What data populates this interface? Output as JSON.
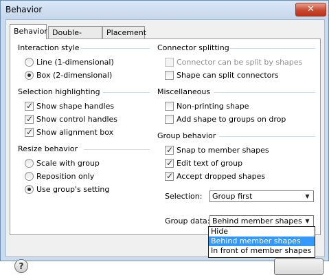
{
  "window": {
    "title": "Behavior",
    "close_glyph": "✕"
  },
  "tabs": [
    {
      "label": "Behavior",
      "active": true
    },
    {
      "label": "Double-Click",
      "active": false
    },
    {
      "label": "Placement",
      "active": false
    }
  ],
  "interaction_style": {
    "heading": "Interaction style",
    "options": [
      {
        "label": "Line (1-dimensional)",
        "selected": false
      },
      {
        "label": "Box (2-dimensional)",
        "selected": true
      }
    ]
  },
  "selection_highlighting": {
    "heading": "Selection highlighting",
    "items": [
      {
        "label": "Show shape handles",
        "checked": true
      },
      {
        "label": "Show control handles",
        "checked": true
      },
      {
        "label": "Show alignment box",
        "checked": true
      }
    ]
  },
  "resize_behavior": {
    "heading": "Resize behavior",
    "options": [
      {
        "label": "Scale with group",
        "selected": false
      },
      {
        "label": "Reposition only",
        "selected": false
      },
      {
        "label": "Use group's setting",
        "selected": true
      }
    ]
  },
  "connector_splitting": {
    "heading": "Connector splitting",
    "items": [
      {
        "label": "Connector can be split by shapes",
        "checked": false,
        "disabled": true
      },
      {
        "label": "Shape can split connectors",
        "checked": false,
        "disabled": false
      }
    ]
  },
  "miscellaneous": {
    "heading": "Miscellaneous",
    "items": [
      {
        "label": "Non-printing shape",
        "checked": false
      },
      {
        "label": "Add shape to groups on drop",
        "checked": false
      }
    ]
  },
  "group_behavior": {
    "heading": "Group behavior",
    "items": [
      {
        "label": "Snap to member shapes",
        "checked": true
      },
      {
        "label": "Edit text of group",
        "checked": true
      },
      {
        "label": "Accept dropped shapes",
        "checked": true
      }
    ],
    "selection_label": "Selection:",
    "selection_value": "Group first",
    "group_data_label": "Group data:",
    "group_data_value": "Behind member shapes",
    "group_data_options": [
      "Hide",
      "Behind member shapes",
      "In front of member shapes"
    ],
    "group_data_highlighted": "Behind member shapes"
  },
  "footer": {
    "help_glyph": "?"
  },
  "icons": {
    "dropdown_arrow": "▼",
    "check": "✓"
  }
}
